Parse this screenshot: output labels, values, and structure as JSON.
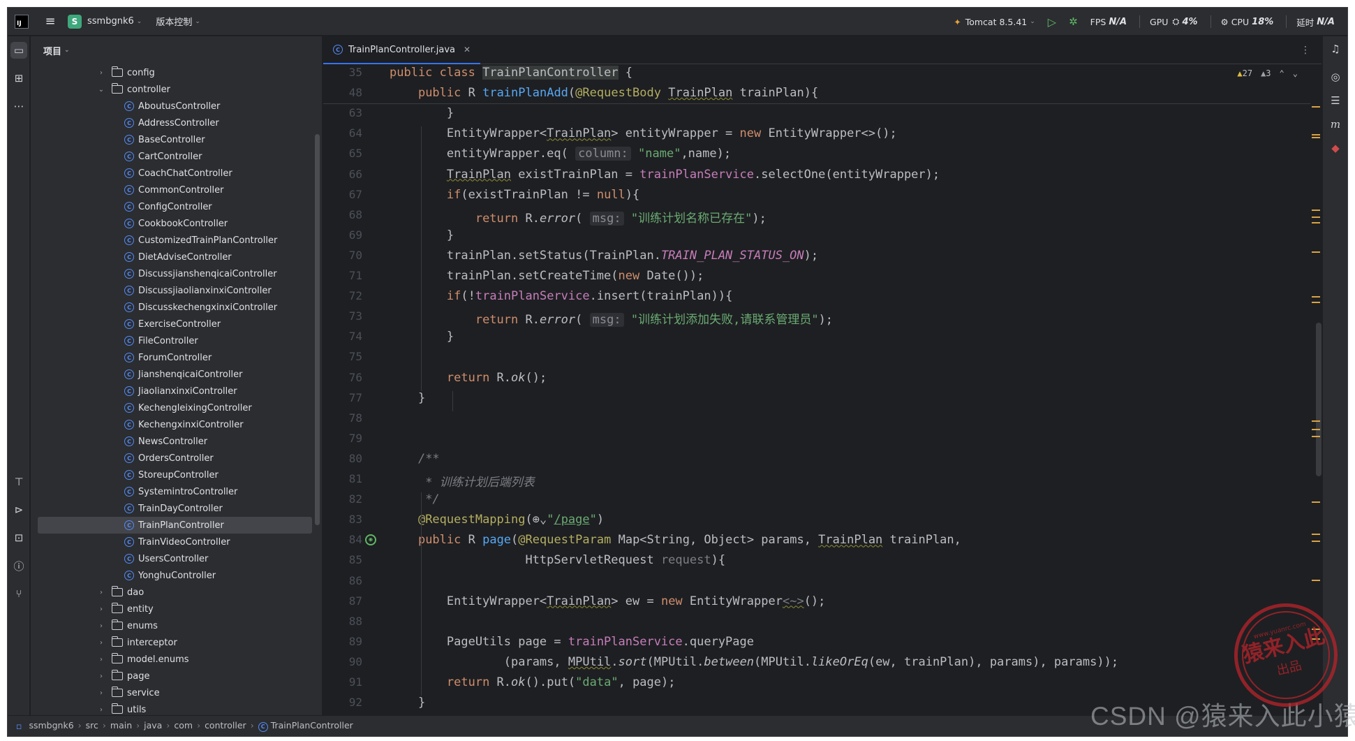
{
  "titlebar": {
    "project_badge": "S",
    "project_name": "ssmbgnk6",
    "vcs": "版本控制",
    "run_config": "Tomcat 8.5.41",
    "fps_label": "FPS",
    "fps_value": "N/A",
    "gpu_label": "GPU",
    "gpu_value": "4%",
    "cpu_label": "CPU",
    "cpu_value": "18%",
    "latency_label": "延时",
    "latency_value": "N/A"
  },
  "project_panel": {
    "title": "项目",
    "tree": [
      {
        "type": "folder",
        "label": "config",
        "expanded": false,
        "depth": 0
      },
      {
        "type": "folder",
        "label": "controller",
        "expanded": true,
        "depth": 0
      },
      {
        "type": "class",
        "label": "AboutusController",
        "depth": 1
      },
      {
        "type": "class",
        "label": "AddressController",
        "depth": 1
      },
      {
        "type": "class",
        "label": "BaseController",
        "depth": 1
      },
      {
        "type": "class",
        "label": "CartController",
        "depth": 1
      },
      {
        "type": "class",
        "label": "CoachChatController",
        "depth": 1
      },
      {
        "type": "class",
        "label": "CommonController",
        "depth": 1
      },
      {
        "type": "class",
        "label": "ConfigController",
        "depth": 1
      },
      {
        "type": "class",
        "label": "CookbookController",
        "depth": 1
      },
      {
        "type": "class",
        "label": "CustomizedTrainPlanController",
        "depth": 1
      },
      {
        "type": "class",
        "label": "DietAdviseController",
        "depth": 1
      },
      {
        "type": "class",
        "label": "DiscussjianshenqicaiController",
        "depth": 1
      },
      {
        "type": "class",
        "label": "DiscussjiaolianxinxiController",
        "depth": 1
      },
      {
        "type": "class",
        "label": "DiscusskechengxinxiController",
        "depth": 1
      },
      {
        "type": "class",
        "label": "ExerciseController",
        "depth": 1
      },
      {
        "type": "class",
        "label": "FileController",
        "depth": 1
      },
      {
        "type": "class",
        "label": "ForumController",
        "depth": 1
      },
      {
        "type": "class",
        "label": "JianshenqicaiController",
        "depth": 1
      },
      {
        "type": "class",
        "label": "JiaolianxinxiController",
        "depth": 1
      },
      {
        "type": "class",
        "label": "KechengleixingController",
        "depth": 1
      },
      {
        "type": "class",
        "label": "KechengxinxiController",
        "depth": 1
      },
      {
        "type": "class",
        "label": "NewsController",
        "depth": 1
      },
      {
        "type": "class",
        "label": "OrdersController",
        "depth": 1
      },
      {
        "type": "class",
        "label": "StoreupController",
        "depth": 1
      },
      {
        "type": "class",
        "label": "SystemintroController",
        "depth": 1
      },
      {
        "type": "class",
        "label": "TrainDayController",
        "depth": 1
      },
      {
        "type": "class",
        "label": "TrainPlanController",
        "depth": 1,
        "selected": true
      },
      {
        "type": "class",
        "label": "TrainVideoController",
        "depth": 1
      },
      {
        "type": "class",
        "label": "UsersController",
        "depth": 1
      },
      {
        "type": "class",
        "label": "YonghuController",
        "depth": 1
      },
      {
        "type": "folder",
        "label": "dao",
        "expanded": false,
        "depth": 0
      },
      {
        "type": "folder",
        "label": "entity",
        "expanded": false,
        "depth": 0
      },
      {
        "type": "folder",
        "label": "enums",
        "expanded": false,
        "depth": 0
      },
      {
        "type": "folder",
        "label": "interceptor",
        "expanded": false,
        "depth": 0
      },
      {
        "type": "folder",
        "label": "model.enums",
        "expanded": false,
        "depth": 0
      },
      {
        "type": "folder",
        "label": "page",
        "expanded": false,
        "depth": 0
      },
      {
        "type": "folder",
        "label": "service",
        "expanded": false,
        "depth": 0
      },
      {
        "type": "folder",
        "label": "utils",
        "expanded": false,
        "depth": 0
      }
    ]
  },
  "editor": {
    "tab_label": "TrainPlanController.java",
    "warnings": "27",
    "weak_warnings": "3",
    "lines": [
      {
        "n": "35",
        "code": "<span class=\"k\">public class</span> <span class=\"hl\">TrainPlanController</span> {"
      },
      {
        "n": "48",
        "code": "    <span class=\"k\">public</span> R <span class=\"fn\">trainPlanAdd</span>(<span class=\"ann\">@RequestBody</span> <span class=\"uw\">TrainPlan</span> trainPlan){"
      },
      {
        "n": "63",
        "code": "        }"
      },
      {
        "n": "64",
        "code": "        EntityWrapper&lt;<span class=\"uw\">TrainPlan</span>&gt; entityWrapper = <span class=\"k\">new</span> EntityWrapper&lt;&gt;();"
      },
      {
        "n": "65",
        "code": "        entityWrapper.eq( <span class=\"hint\">column:</span> <span class=\"str\">\"name\"</span>,name);"
      },
      {
        "n": "66",
        "code": "        <span class=\"uw\">TrainPlan</span> existTrainPlan = <span class=\"fld\">trainPlanService</span>.selectOne(entityWrapper);"
      },
      {
        "n": "67",
        "code": "        <span class=\"k\">if</span>(existTrainPlan != <span class=\"k\">null</span>){"
      },
      {
        "n": "68",
        "code": "            <span class=\"k\">return</span> R.<span class=\"ital\">error</span>( <span class=\"hint\">msg:</span> <span class=\"str\">\"训练计划名称已存在\"</span>);"
      },
      {
        "n": "69",
        "code": "        }"
      },
      {
        "n": "70",
        "code": "        trainPlan.setStatus(TrainPlan.<span class=\"fld ital\">TRAIN_PLAN_STATUS_ON</span>);"
      },
      {
        "n": "71",
        "code": "        trainPlan.setCreateTime(<span class=\"k\">new</span> Date());"
      },
      {
        "n": "72",
        "code": "        <span class=\"k\">if</span>(!<span class=\"fld\">trainPlanService</span>.insert(trainPlan)){"
      },
      {
        "n": "73",
        "code": "            <span class=\"k\">return</span> R.<span class=\"ital\">error</span>( <span class=\"hint\">msg:</span> <span class=\"str\">\"训练计划添加失败,请联系管理员\"</span>);"
      },
      {
        "n": "74",
        "code": "        }"
      },
      {
        "n": "75",
        "code": ""
      },
      {
        "n": "76",
        "code": "        <span class=\"k\">return</span> R.<span class=\"ital\">ok</span>();"
      },
      {
        "n": "77",
        "code": "    }"
      },
      {
        "n": "78",
        "code": ""
      },
      {
        "n": "79",
        "code": ""
      },
      {
        "n": "80",
        "code": "    <span class=\"cm\">/**</span>"
      },
      {
        "n": "81",
        "code": "    <span class=\"cm\"> * 训练计划后端列表</span>"
      },
      {
        "n": "82",
        "code": "    <span class=\"cm\"> */</span>"
      },
      {
        "n": "83",
        "code": "    <span class=\"ann\">@RequestMapping</span>(⊕⌄<span class=\"str\">\"<span class=\"ul\">/page</span>\"</span>)"
      },
      {
        "n": "84",
        "code": "    <span class=\"k\">public</span> R <span class=\"fn\">page</span>(<span class=\"ann\">@RequestParam</span> Map&lt;String, Object&gt; params, <span class=\"uw\">TrainPlan</span> trainPlan,"
      },
      {
        "n": "85",
        "code": "                   HttpServletRequest <span style=\"color:#7a7e85\">request</span>){"
      },
      {
        "n": "86",
        "code": ""
      },
      {
        "n": "87",
        "code": "        EntityWrapper&lt;<span class=\"uw\">TrainPlan</span>&gt; ew = <span class=\"k\">new</span> EntityWrapper<span class=\"uw\" style=\"color:#7a7e85\">&lt;~&gt;</span>();"
      },
      {
        "n": "88",
        "code": ""
      },
      {
        "n": "89",
        "code": "        PageUtils page = <span class=\"fld\">trainPlanService</span>.queryPage"
      },
      {
        "n": "90",
        "code": "                (params, <span class=\"uw\">MPUtil</span>.<span class=\"ital\">sort</span>(MPUtil.<span class=\"ital\">between</span>(MPUtil.<span class=\"ital\">likeOrEq</span>(ew, trainPlan), params), params));"
      },
      {
        "n": "91",
        "code": "        <span class=\"k\">return</span> R.<span class=\"ital\">ok</span>().put(<span class=\"str\">\"data\"</span>, page);"
      },
      {
        "n": "92",
        "code": "    }"
      }
    ]
  },
  "statusbar": {
    "breadcrumbs": [
      "ssmbgnk6",
      "src",
      "main",
      "java",
      "com",
      "controller",
      "TrainPlanController"
    ]
  },
  "watermark": {
    "text": "CSDN @猿来入此小猿",
    "seal_top": "www.yuanrc.com",
    "seal_main": "猿来入此",
    "seal_bottom": "出品"
  },
  "colors": {
    "background": "#1e1f22",
    "panel": "#2b2d30",
    "keyword": "#cf8e6d",
    "function": "#56a8f5",
    "string": "#6aab73",
    "annotation": "#b3ae60",
    "field": "#c77dbb",
    "accent": "#3574f0",
    "seal_red": "#b3242a"
  }
}
